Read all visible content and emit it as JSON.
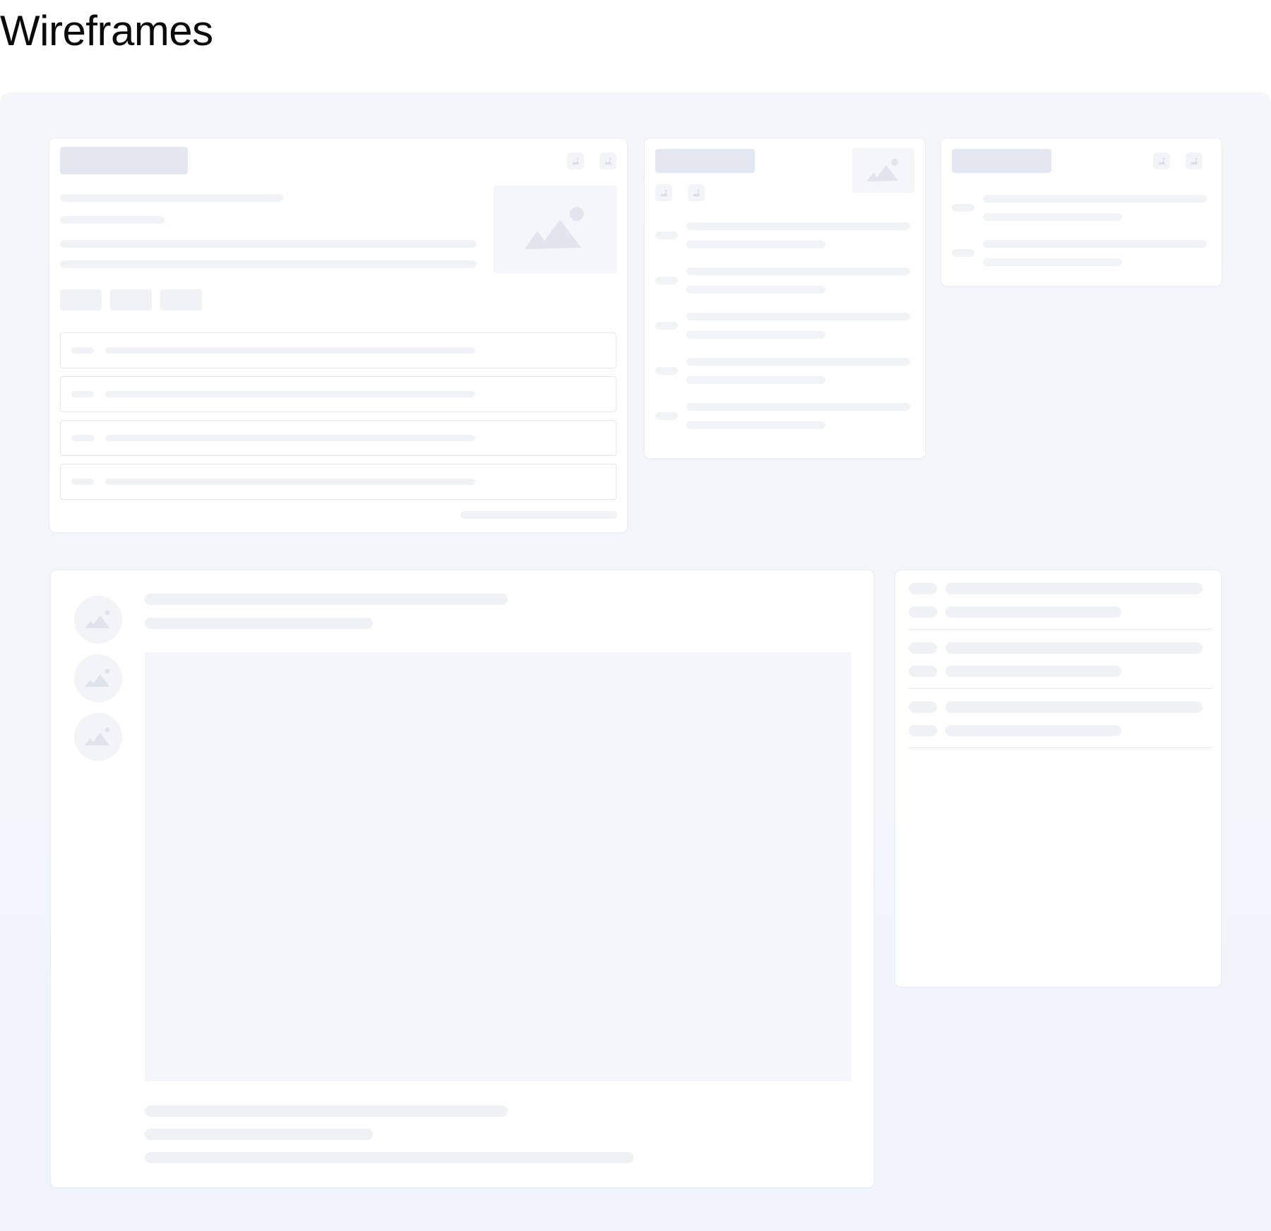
{
  "page": {
    "title": "Wireframes"
  },
  "colors": {
    "canvas_background": "#f4f6fa",
    "card_background": "#ffffff",
    "placeholder_light": "#f2f3f6",
    "placeholder_dark": "#e3e7ef",
    "image_placeholder": "#f5f6f9",
    "icon_fill": "#dfe3ec"
  },
  "icons": {
    "image": "image-icon",
    "edit": "edit-icon"
  }
}
